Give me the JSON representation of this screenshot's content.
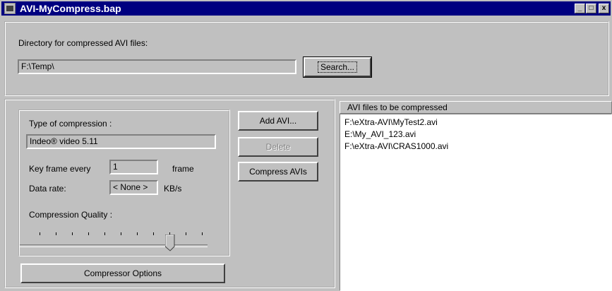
{
  "window": {
    "title": "AVI-MyCompress.bap",
    "controls": {
      "minimize": "_",
      "maximize": "□",
      "close": "x"
    }
  },
  "directory": {
    "label": "Directory for compressed AVI files:",
    "value": "F:\\Temp\\",
    "search_button": "Search..."
  },
  "compression": {
    "type_label": "Type of compression :",
    "type_value": "Indeo® video 5.11",
    "keyframe_label": "Key frame every",
    "keyframe_value": "1",
    "keyframe_unit": "frame",
    "datarate_label": "Data rate:",
    "datarate_value": "< None >",
    "datarate_unit": "KB/s",
    "quality_label": "Compression Quality :",
    "quality_position": 0.75,
    "compressor_options_button": "Compressor Options"
  },
  "actions": {
    "add_avi": "Add AVI...",
    "delete": "Delete",
    "compress": "Compress AVIs"
  },
  "file_list": {
    "header": "AVI files to be compressed",
    "items": [
      "F:\\eXtra-AVI\\MyTest2.avi",
      "E:\\My_AVI_123.avi",
      "F:\\eXtra-AVI\\CRAS1000.avi"
    ]
  }
}
